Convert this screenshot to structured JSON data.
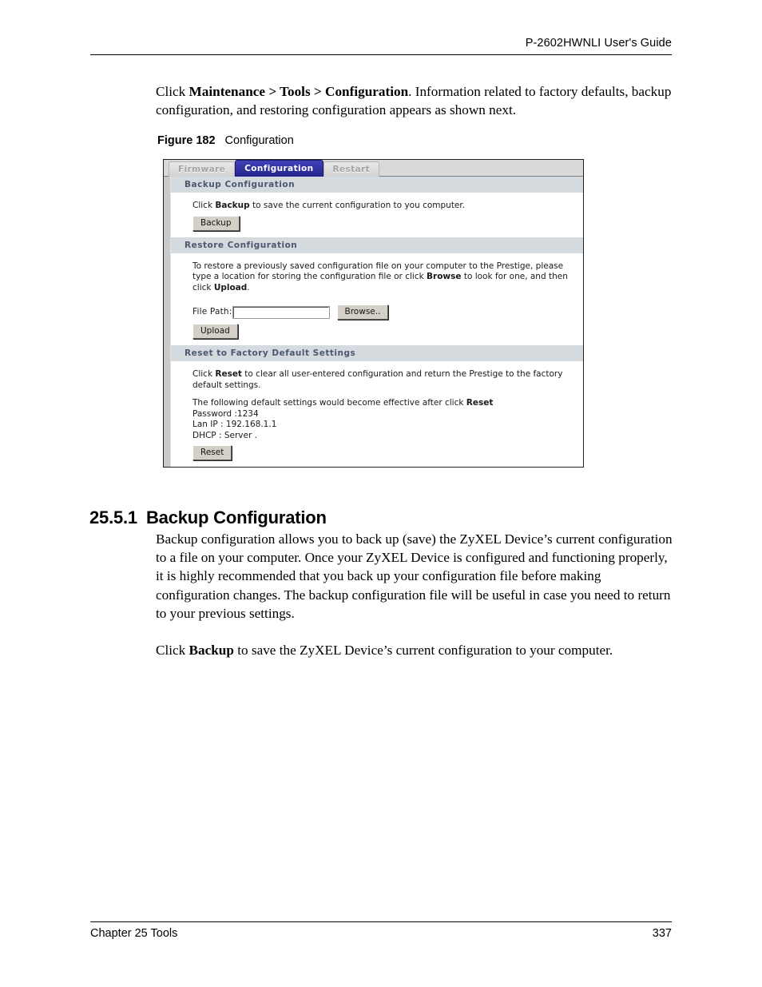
{
  "document": {
    "header_title": "P-2602HWNLI User's Guide",
    "footer_left": "Chapter 25 Tools",
    "footer_page": "337"
  },
  "intro": {
    "click_word": "Click ",
    "path_maintenance": "Maintenance",
    "sep1": " > ",
    "path_tools": "Tools",
    "sep2": " > ",
    "path_configuration": "Configuration",
    "rest": ". Information related to factory defaults, backup configuration, and restoring configuration appears as shown next."
  },
  "figure": {
    "label": "Figure 182",
    "title": "Configuration",
    "tabs": [
      {
        "label": "Firmware",
        "active": false
      },
      {
        "label": "Configuration",
        "active": true
      },
      {
        "label": "Restart",
        "active": false
      }
    ],
    "backup_section": {
      "heading": "Backup Configuration",
      "text_prefix": "Click ",
      "text_bold": "Backup",
      "text_suffix": " to save the current configuration to you computer.",
      "button": "Backup"
    },
    "restore_section": {
      "heading": "Restore Configuration",
      "text_part1": "To restore a previously saved configuration file on your computer to the Prestige, please type a location for storing the configuration file or click ",
      "text_bold1": "Browse",
      "text_part2": " to look for one, and then click ",
      "text_bold2": "Upload",
      "text_part3": ".",
      "file_path_label": "File Path:",
      "file_path_value": "",
      "file_path_placeholder": "",
      "browse_button": "Browse..",
      "upload_button": "Upload"
    },
    "reset_section": {
      "heading": "Reset to Factory Default Settings",
      "text_part1": "Click ",
      "text_bold1": "Reset",
      "text_part2": " to clear all user-entered configuration and return the Prestige to the factory default settings.",
      "effective_prefix": "The following default settings would become effective after click ",
      "effective_bold": "Reset",
      "defaults": [
        "Password :1234",
        "Lan IP : 192.168.1.1",
        "DHCP : Server ."
      ],
      "reset_button": "Reset"
    }
  },
  "section": {
    "number": "25.5.1",
    "title": "Backup Configuration",
    "paragraph1": "Backup configuration allows you to back up (save) the ZyXEL Device’s current configuration to a file on your computer. Once your ZyXEL Device is configured and functioning properly, it is highly recommended that you back up your configuration file before making configuration changes. The backup configuration file will be useful in case you need to return to your previous settings.",
    "paragraph2_prefix": "Click ",
    "paragraph2_bold": "Backup",
    "paragraph2_suffix": " to save the ZyXEL Device’s current configuration to your computer."
  },
  "colors": {
    "tab_active_bg": "#23238c",
    "section_header_bg": "#d4dade",
    "section_header_text": "#4b5870",
    "button_face": "#d4d0c8"
  }
}
